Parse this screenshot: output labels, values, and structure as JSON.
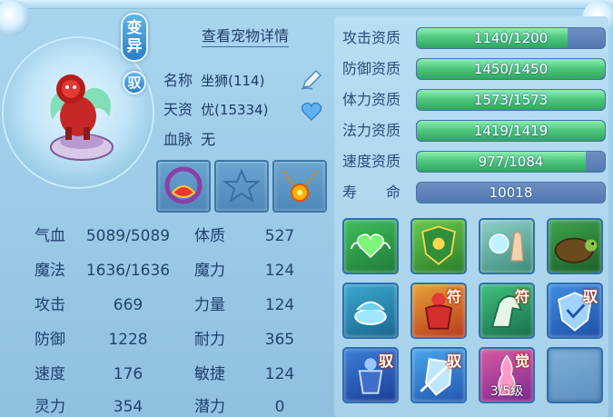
{
  "header": {
    "detail_link": "查看宠物详情"
  },
  "badges": {
    "mutant_chars": [
      "变",
      "异"
    ],
    "tame": "驭"
  },
  "info": {
    "name_label": "名称",
    "name_value": "坐狮(114)",
    "talent_label": "天资",
    "talent_value": "优(15334)",
    "blood_label": "血脉",
    "blood_value": "无"
  },
  "equipment": [
    {
      "name": "red-gem-collar"
    },
    {
      "name": "empty-star-slot"
    },
    {
      "name": "gold-flower-necklace"
    }
  ],
  "stats": [
    {
      "label": "气血",
      "value": "5089/5089",
      "label2": "体质",
      "value2": "527"
    },
    {
      "label": "魔法",
      "value": "1636/1636",
      "label2": "魔力",
      "value2": "124"
    },
    {
      "label": "攻击",
      "value": "669",
      "label2": "力量",
      "value2": "124"
    },
    {
      "label": "防御",
      "value": "1228",
      "label2": "耐力",
      "value2": "365"
    },
    {
      "label": "速度",
      "value": "176",
      "label2": "敏捷",
      "value2": "124"
    },
    {
      "label": "灵力",
      "value": "354",
      "label2": "潜力",
      "value2": "0"
    }
  ],
  "aptitudes": [
    {
      "label": "攻击资质",
      "text": "1140/1200",
      "fraction": 0.8
    },
    {
      "label": "防御资质",
      "text": "1450/1450",
      "fraction": 1.0
    },
    {
      "label": "体力资质",
      "text": "1573/1573",
      "fraction": 1.0
    },
    {
      "label": "法力资质",
      "text": "1419/1419",
      "fraction": 1.0
    },
    {
      "label": "速度资质",
      "text": "977/1084",
      "fraction": 0.9
    },
    {
      "label": "寿　　命",
      "text": "10018",
      "fraction": 0
    }
  ],
  "skills": [
    {
      "name": "green-heart-wings-skill",
      "tag": "",
      "level": ""
    },
    {
      "name": "green-shield-crest-skill",
      "tag": "",
      "level": ""
    },
    {
      "name": "orb-hand-skill",
      "tag": "",
      "level": ""
    },
    {
      "name": "turtle-skill",
      "tag": "",
      "level": ""
    },
    {
      "name": "cauldron-skill",
      "tag": "",
      "level": ""
    },
    {
      "name": "red-muscle-man-skill",
      "tag": "符",
      "level": ""
    },
    {
      "name": "green-horse-skill",
      "tag": "符",
      "level": ""
    },
    {
      "name": "blue-shield-skill",
      "tag": "驭",
      "level": ""
    },
    {
      "name": "blue-warrior-skill",
      "tag": "驭",
      "level": ""
    },
    {
      "name": "blue-shield-slash-skill",
      "tag": "驭",
      "level": ""
    },
    {
      "name": "awakened-figure-skill",
      "tag": "觉",
      "level": "3/5级"
    },
    {
      "name": "empty-skill-slot",
      "tag": "",
      "level": ""
    }
  ],
  "colors": {
    "bar_fill": "#50c880",
    "bar_empty": "#5279b2",
    "background": "#9fcde9",
    "badge": "#2d7ec6"
  }
}
